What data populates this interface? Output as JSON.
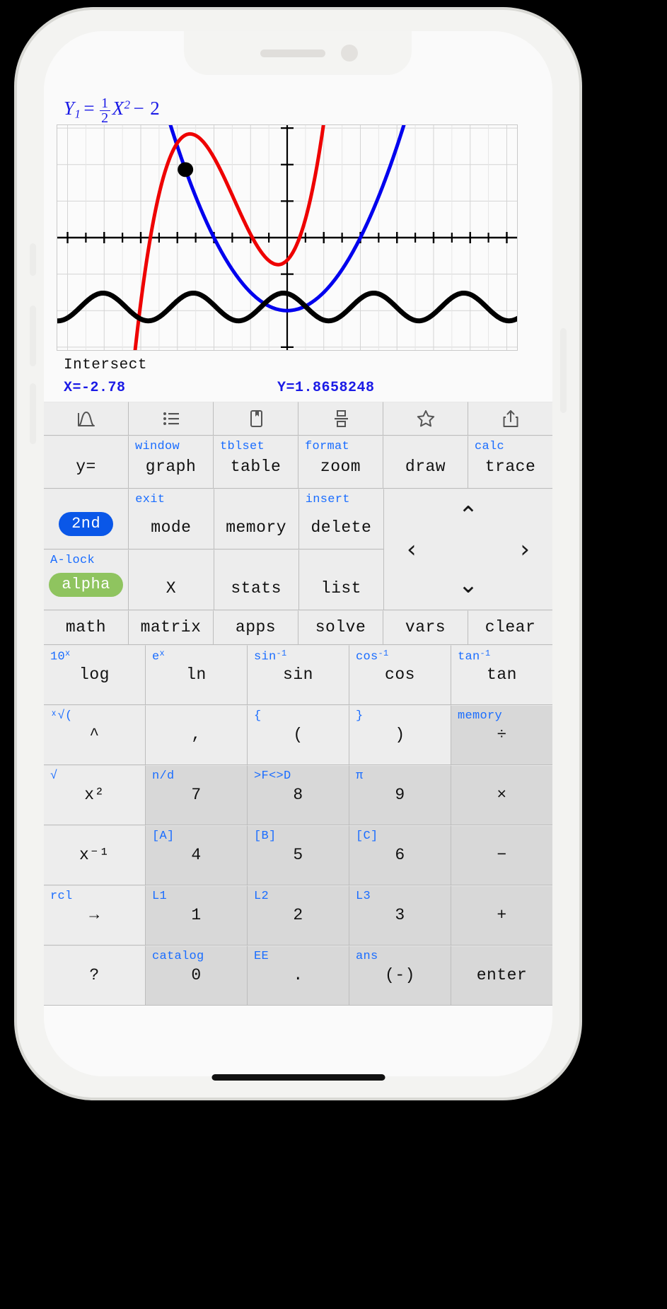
{
  "app": {
    "equation": {
      "lhs": "Y",
      "lhs_sub": "1",
      "eq": "=",
      "frac_num": "1",
      "frac_den": "2",
      "var": "X",
      "var_exp": "2",
      "minus": "−",
      "constant": "2",
      "color": "#1a1ae6",
      "plain": "Y1 = 1/2 X^2 − 2"
    },
    "status": {
      "label": "Intersect",
      "x_value": "X=-2.78",
      "y_value": "Y=1.8658248",
      "value_color": "#1a1ae6"
    },
    "toolbar_icons": [
      {
        "name": "distribution-curve-icon",
        "glyph": "distribution"
      },
      {
        "name": "list-icon",
        "glyph": "list"
      },
      {
        "name": "book-bookmark-icon",
        "glyph": "book"
      },
      {
        "name": "fraction-stack-icon",
        "glyph": "fraction"
      },
      {
        "name": "star-icon",
        "glyph": "star"
      },
      {
        "name": "share-icon",
        "glyph": "share"
      }
    ],
    "keypad": {
      "row_fn": [
        {
          "second": "",
          "main": "y="
        },
        {
          "second": "window",
          "main": "graph"
        },
        {
          "second": "tblset",
          "main": "table"
        },
        {
          "second": "format",
          "main": "zoom"
        },
        {
          "second": "",
          "main": "draw"
        },
        {
          "second": "calc",
          "main": "trace"
        }
      ],
      "row_2nd": [
        {
          "second": "",
          "main": "2nd",
          "pill": "blue"
        },
        {
          "second": "exit",
          "main": "mode"
        },
        {
          "second": "",
          "main": "memory"
        },
        {
          "second": "insert",
          "main": "delete"
        }
      ],
      "row_alpha": [
        {
          "second": "A-lock",
          "main": "alpha",
          "pill": "green"
        },
        {
          "second": "",
          "main": "X"
        },
        {
          "second": "",
          "main": "stats"
        },
        {
          "second": "",
          "main": "list"
        }
      ],
      "dpad": {
        "up": "⌃",
        "down": "⌄",
        "left": "‹",
        "right": "›"
      },
      "row_math": [
        "math",
        "matrix",
        "apps",
        "solve",
        "vars",
        "clear"
      ],
      "row_trig": [
        {
          "second": "10",
          "second_sup": "x",
          "main": "log",
          "dark": false
        },
        {
          "second": "e",
          "second_sup": "x",
          "main": "ln",
          "dark": false
        },
        {
          "second": "sin",
          "second_sup": "-1",
          "main": "sin",
          "dark": false
        },
        {
          "second": "cos",
          "second_sup": "-1",
          "main": "cos",
          "dark": false
        },
        {
          "second": "tan",
          "second_sup": "-1",
          "main": "tan",
          "dark": false
        }
      ],
      "row_paren": [
        {
          "second": "ˣ√(",
          "main": "^",
          "dark": false
        },
        {
          "second": "",
          "main": ",",
          "dark": false
        },
        {
          "second": "{",
          "main": "(",
          "dark": false
        },
        {
          "second": "}",
          "main": ")",
          "dark": false
        },
        {
          "second": "memory",
          "main": "÷",
          "dark": true
        }
      ],
      "row_789": [
        {
          "second": "√",
          "main": "x²",
          "dark": false
        },
        {
          "second": "n/d",
          "main": "7",
          "dark": true
        },
        {
          "second": ">F<>D",
          "main": "8",
          "dark": true
        },
        {
          "second": "π",
          "main": "9",
          "dark": true
        },
        {
          "second": "",
          "main": "×",
          "dark": true
        }
      ],
      "row_456": [
        {
          "second": "",
          "main": "x⁻¹",
          "dark": false
        },
        {
          "second": "[A]",
          "main": "4",
          "dark": true
        },
        {
          "second": "[B]",
          "main": "5",
          "dark": true
        },
        {
          "second": "[C]",
          "main": "6",
          "dark": true
        },
        {
          "second": "",
          "main": "−",
          "dark": true
        }
      ],
      "row_123": [
        {
          "second": "rcl",
          "main": "→",
          "dark": false
        },
        {
          "second": "L1",
          "main": "1",
          "dark": true
        },
        {
          "second": "L2",
          "main": "2",
          "dark": true
        },
        {
          "second": "L3",
          "main": "3",
          "dark": true
        },
        {
          "second": "",
          "main": "+",
          "dark": true
        }
      ],
      "row_0": [
        {
          "second": "",
          "main": "?",
          "dark": false
        },
        {
          "second": "catalog",
          "main": "0",
          "dark": true
        },
        {
          "second": "EE",
          "main": ".",
          "dark": true
        },
        {
          "second": "ans",
          "main": "(-)",
          "dark": true
        },
        {
          "second": "",
          "main": "enter",
          "dark": true
        }
      ]
    }
  },
  "chart_data": {
    "type": "line",
    "title": "",
    "xlabel": "",
    "ylabel": "",
    "xlim": [
      -6.3,
      6.3
    ],
    "ylim": [
      -3.1,
      3.1
    ],
    "grid": true,
    "legend": false,
    "axis_ticks_x": [
      -6,
      -5,
      -4,
      -3,
      -2,
      -1,
      1,
      2,
      3,
      4,
      5,
      6
    ],
    "axis_ticks_y": [
      -3,
      -2,
      -1,
      1,
      2,
      3
    ],
    "series": [
      {
        "name": "Y1 = 0.5*X^2 - 2",
        "color": "#0000ee",
        "expr": "0.5*x*x - 2",
        "width": 5
      },
      {
        "name": "Y2 (cubic)",
        "color": "#ee0000",
        "expr": "0.42*(x+1.4)^3 - 1.3*(x+1.4) + 0.55",
        "width": 5
      },
      {
        "name": "Y3 (wave)",
        "color": "#000000",
        "expr": "-1.85 + 0.42*cos(2.55*x)",
        "width": 7
      }
    ],
    "points": [
      {
        "name": "intersection",
        "x": -2.78,
        "y": 1.8658248,
        "color": "#000000",
        "r": 11
      }
    ]
  }
}
